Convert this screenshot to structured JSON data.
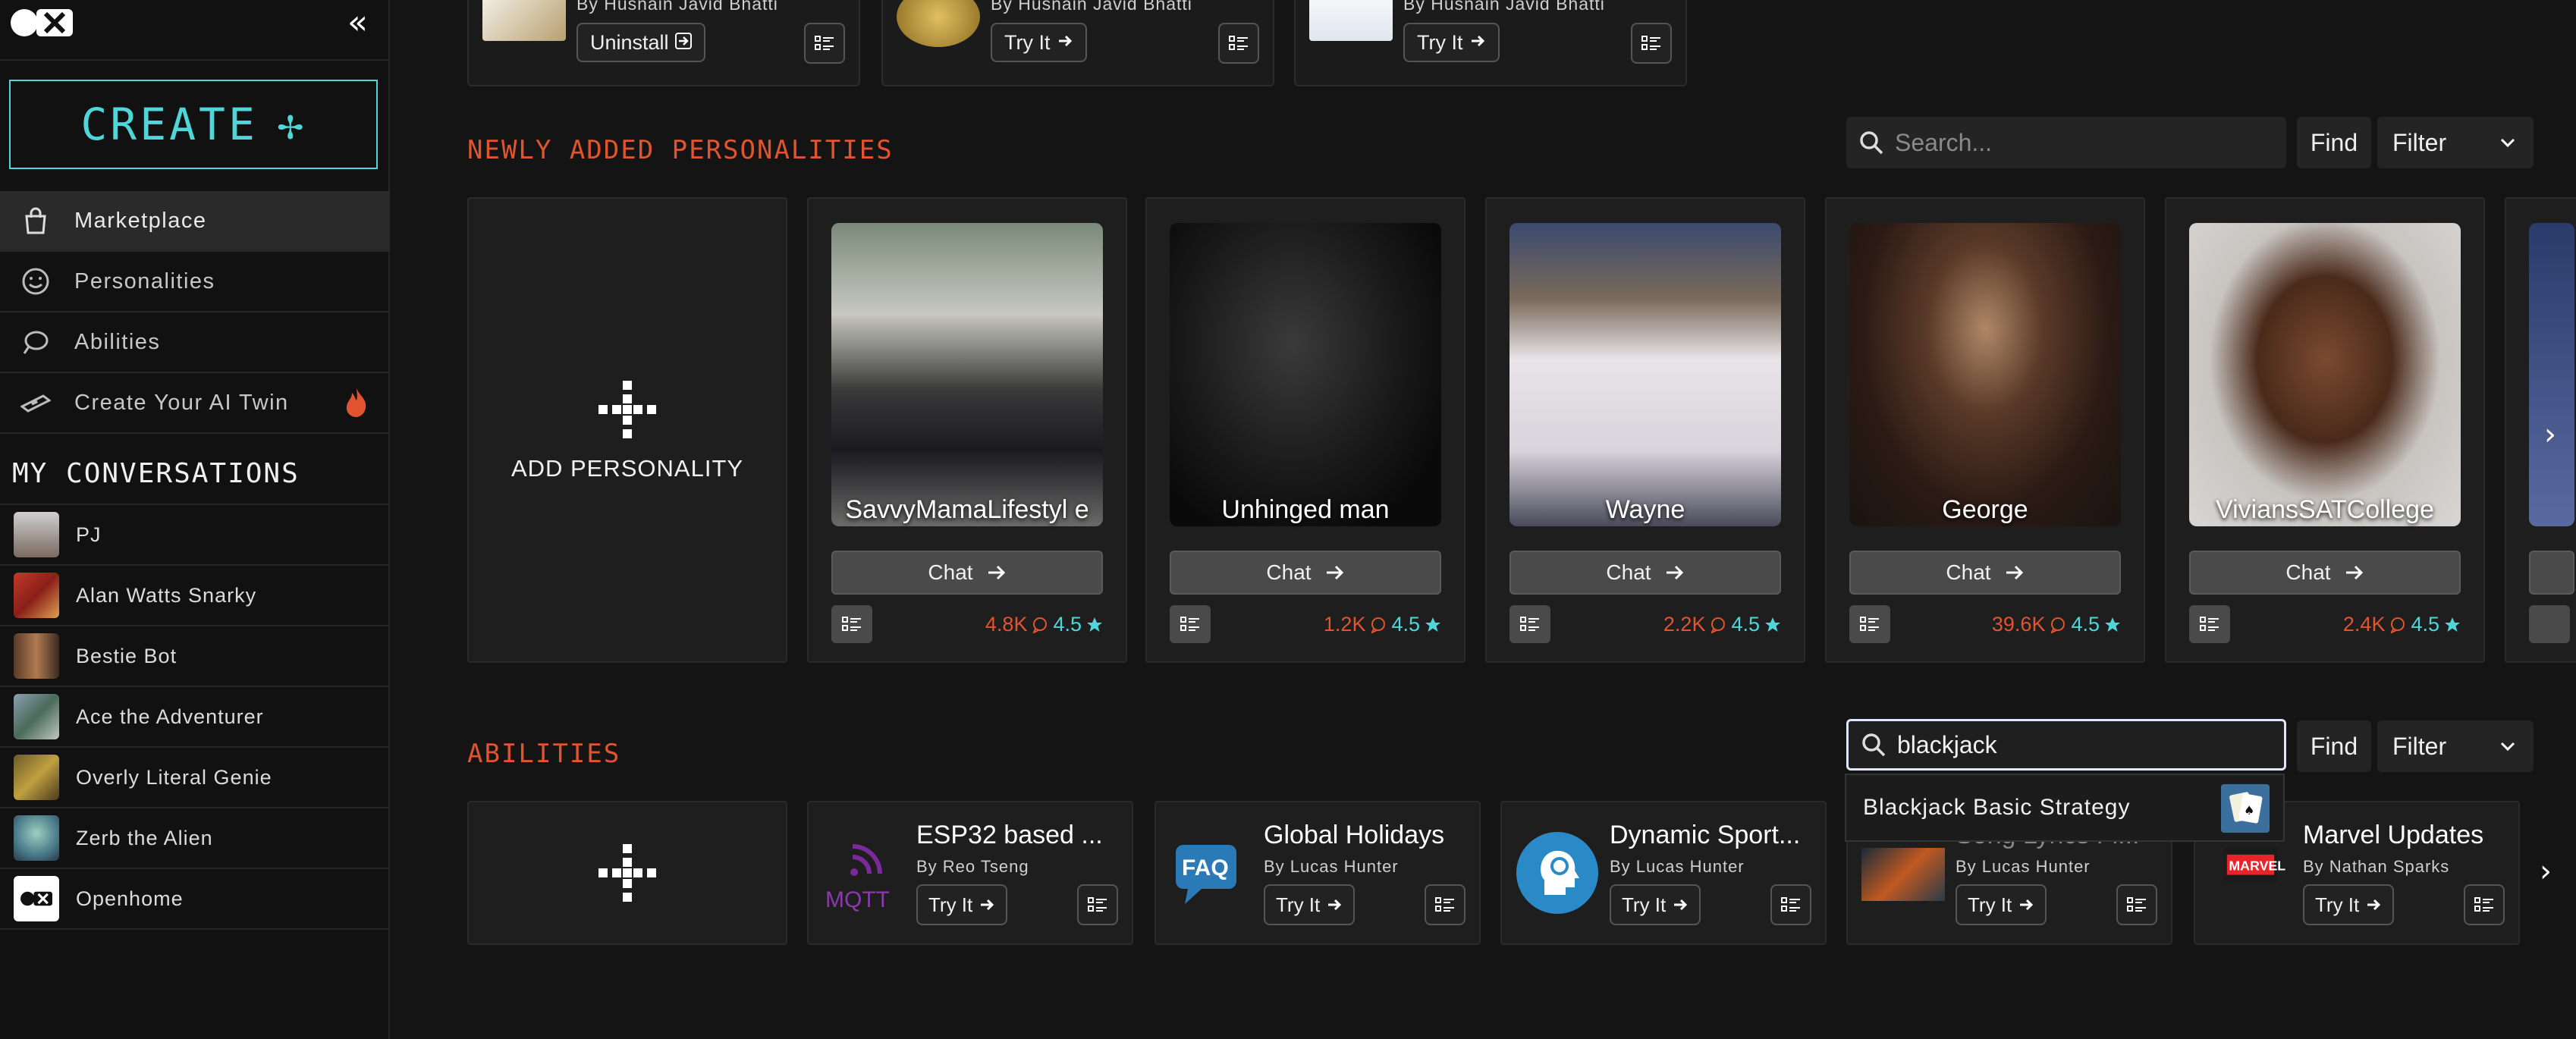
{
  "sidebar": {
    "create_label": "CREATE",
    "nav": [
      {
        "label": "Marketplace",
        "icon": "shopping-bag-icon"
      },
      {
        "label": "Personalities",
        "icon": "smiley-icon"
      },
      {
        "label": "Abilities",
        "icon": "ability-icon"
      },
      {
        "label": "Create Your AI Twin",
        "icon": "vr-headset-icon"
      }
    ],
    "conversations_title": "MY CONVERSATIONS",
    "conversations": [
      {
        "label": "PJ"
      },
      {
        "label": "Alan Watts Snarky"
      },
      {
        "label": "Bestie Bot"
      },
      {
        "label": "Ace the Adventurer"
      },
      {
        "label": "Overly Literal Genie"
      },
      {
        "label": "Zerb the Alien"
      },
      {
        "label": "Openhome"
      }
    ]
  },
  "top_row": [
    {
      "by": "By Husnain Javid Bhatti",
      "action": "Uninstall"
    },
    {
      "by": "By Husnain Javid Bhatti",
      "action": "Try It"
    },
    {
      "by": "By Husnain Javid Bhatti",
      "action": "Try It"
    }
  ],
  "personalities": {
    "title": "NEWLY ADDED PERSONALITIES",
    "search_placeholder": "Search...",
    "find_label": "Find",
    "filter_label": "Filter",
    "add_label": "ADD PERSONALITY",
    "chat_label": "Chat",
    "cards": [
      {
        "name": "SavvyMamaLifestyl e",
        "count": "4.8K",
        "rating": "4.5"
      },
      {
        "name": "Unhinged man",
        "count": "1.2K",
        "rating": "4.5"
      },
      {
        "name": "Wayne",
        "count": "2.2K",
        "rating": "4.5"
      },
      {
        "name": "George",
        "count": "39.6K",
        "rating": "4.5"
      },
      {
        "name": "ViviansSATCollege",
        "count": "2.4K",
        "rating": "4.5"
      }
    ]
  },
  "abilities": {
    "title": "ABILITIES",
    "search_value": "blackjack",
    "find_label": "Find",
    "filter_label": "Filter",
    "try_label": "Try It",
    "dropdown_item": "Blackjack Basic Strategy",
    "cards": [
      {
        "name": "ESP32 based ...",
        "by": "By Reo Tseng"
      },
      {
        "name": "Global Holidays",
        "by": "By Lucas Hunter"
      },
      {
        "name": "Dynamic Sport...",
        "by": "By Lucas Hunter"
      },
      {
        "name": "Song Lyrics Fi...",
        "by": "By Lucas Hunter"
      },
      {
        "name": "Marvel Updates",
        "by": "By Nathan Sparks"
      }
    ]
  },
  "colors": {
    "accent": "#e0552f",
    "teal": "#4fd6d9",
    "bg": "#141414"
  }
}
